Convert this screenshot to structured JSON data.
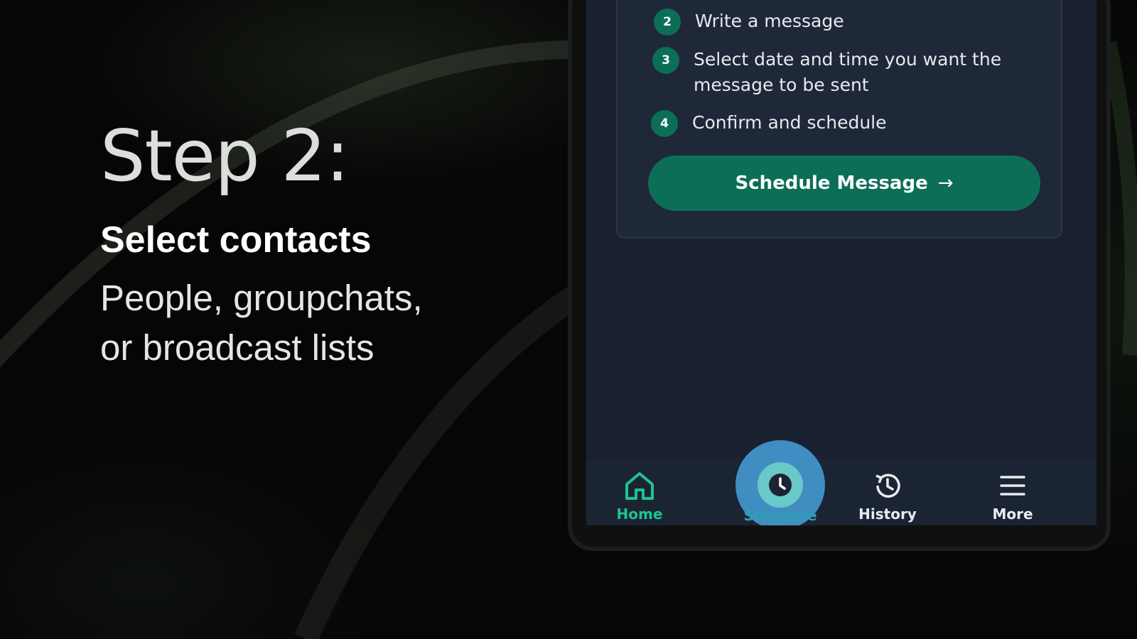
{
  "slide": {
    "step_title": "Step 2:",
    "heading": "Select contacts",
    "description_line1": "People, groupchats,",
    "description_line2": "or broadcast lists"
  },
  "card": {
    "steps": [
      {
        "number": "2",
        "text_line1": "Write a message",
        "text_line2": ""
      },
      {
        "number": "3",
        "text_line1": "Select date and time you want the",
        "text_line2": "message to be sent"
      },
      {
        "number": "4",
        "text_line1": "Confirm and schedule",
        "text_line2": ""
      }
    ],
    "cta_label": "Schedule Message",
    "cta_arrow": "→"
  },
  "nav": {
    "items": [
      {
        "label": "Home",
        "icon": "home-icon",
        "active": true
      },
      {
        "label": "Schedule",
        "icon": "clock-icon",
        "highlighted": true
      },
      {
        "label": "History",
        "icon": "history-icon"
      },
      {
        "label": "More",
        "icon": "menu-icon"
      }
    ]
  },
  "colors": {
    "accent_green": "#0d6e57",
    "home_active": "#1fc38f",
    "screen_bg": "#192130",
    "highlight": "#46a0dc"
  }
}
